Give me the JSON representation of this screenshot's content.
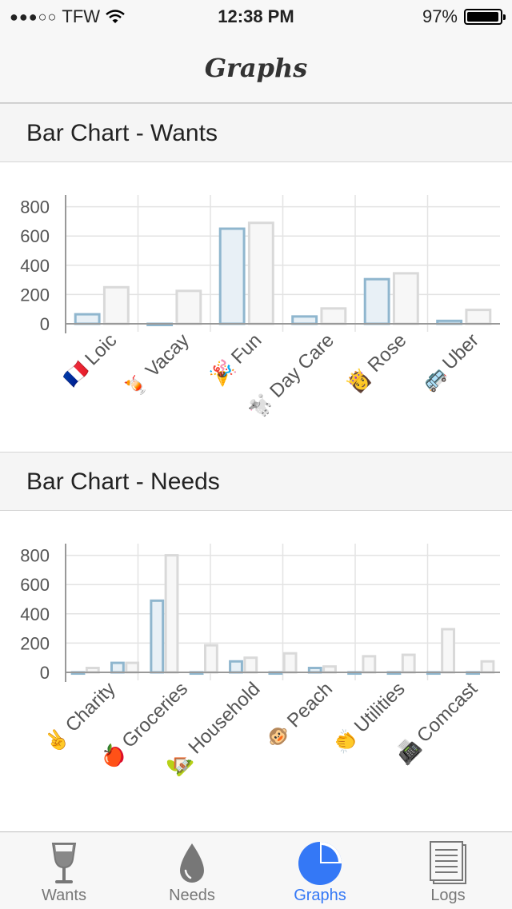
{
  "status": {
    "carrier": "TFW",
    "time": "12:38 PM",
    "battery": "97%",
    "battery_level": 0.97
  },
  "nav": {
    "title": "Graphs"
  },
  "sections": {
    "wants": "Bar Chart - Wants",
    "needs": "Bar Chart - Needs"
  },
  "tabs": [
    {
      "label": "Wants",
      "icon": "wine-glass-icon"
    },
    {
      "label": "Needs",
      "icon": "water-drop-icon"
    },
    {
      "label": "Graphs",
      "icon": "pie-chart-icon"
    },
    {
      "label": "Logs",
      "icon": "document-list-icon"
    }
  ],
  "colors": {
    "accent": "#3478f6",
    "bar_blue": "#8fb6ce",
    "bar_blue_fill": "#e8f0f6",
    "bar_gray": "#d9d9d9",
    "bar_gray_fill": "#f7f7f7"
  },
  "chart_data": [
    {
      "type": "bar",
      "categories": [
        "🇫🇷 Loic",
        "🍹 Vacay",
        "🎉 Fun",
        "🐩 Day Care",
        "👸 Rose",
        "🚌 Uber"
      ],
      "series": [
        {
          "values": [
            65,
            -10,
            650,
            50,
            305,
            20
          ]
        },
        {
          "values": [
            250,
            225,
            690,
            105,
            345,
            95
          ]
        }
      ],
      "yticks": [
        "0",
        "200",
        "400",
        "600",
        "800"
      ],
      "ylim": [
        -30,
        880
      ]
    },
    {
      "type": "bar",
      "categories": [
        "✌️ Charity",
        "🍎 Groceries",
        "🏡 Household",
        "🐵 Peach",
        "👏 Utilities",
        "📠 Comcast"
      ],
      "series": [
        {
          "values": [
            -10,
            65,
            490,
            -10,
            75,
            -10,
            30,
            -10,
            -10,
            -10,
            -10
          ]
        },
        {
          "values": [
            30,
            65,
            800,
            185,
            100,
            130,
            40,
            110,
            120,
            295,
            75
          ]
        }
      ],
      "yticks": [
        "0",
        "200",
        "400",
        "600",
        "800"
      ],
      "ylim": [
        -30,
        880
      ]
    }
  ]
}
